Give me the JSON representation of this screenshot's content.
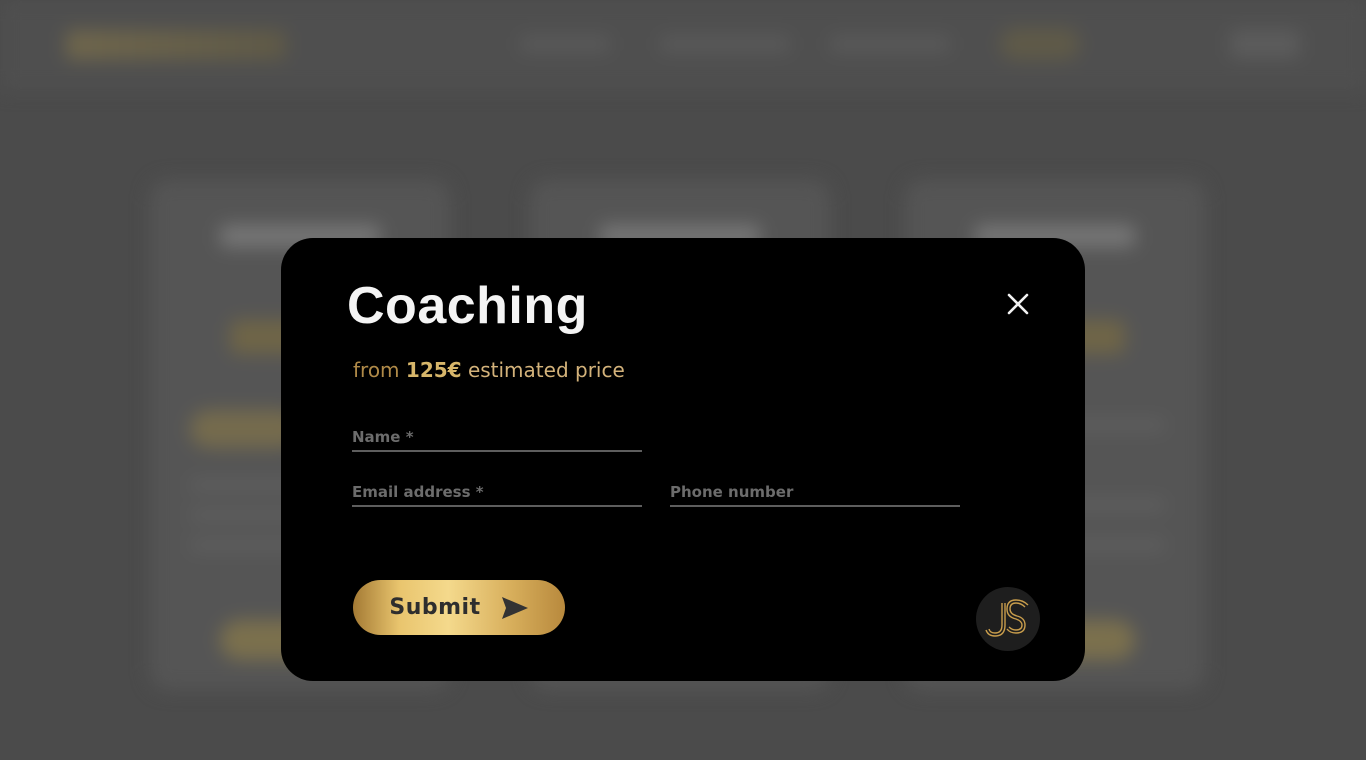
{
  "modal": {
    "title": "Coaching",
    "price": {
      "prefix": "from",
      "amount": "125€",
      "suffix": "estimated price"
    },
    "fields": {
      "name": {
        "placeholder": "Name *",
        "value": ""
      },
      "email": {
        "placeholder": "Email address *",
        "value": ""
      },
      "phone": {
        "placeholder": "Phone number",
        "value": ""
      }
    },
    "submit_label": "Submit",
    "badge_text": "JS"
  },
  "icons": {
    "close": "close-icon",
    "submit": "send-arrow-icon",
    "badge": "js-logo-icon"
  },
  "colors": {
    "modal_bg": "#000000",
    "overlay_bg": "#4b4b4b",
    "accent_gold": "#d7b66a",
    "title_text": "#f4f4f4",
    "field_underline": "#5e5e5e"
  }
}
